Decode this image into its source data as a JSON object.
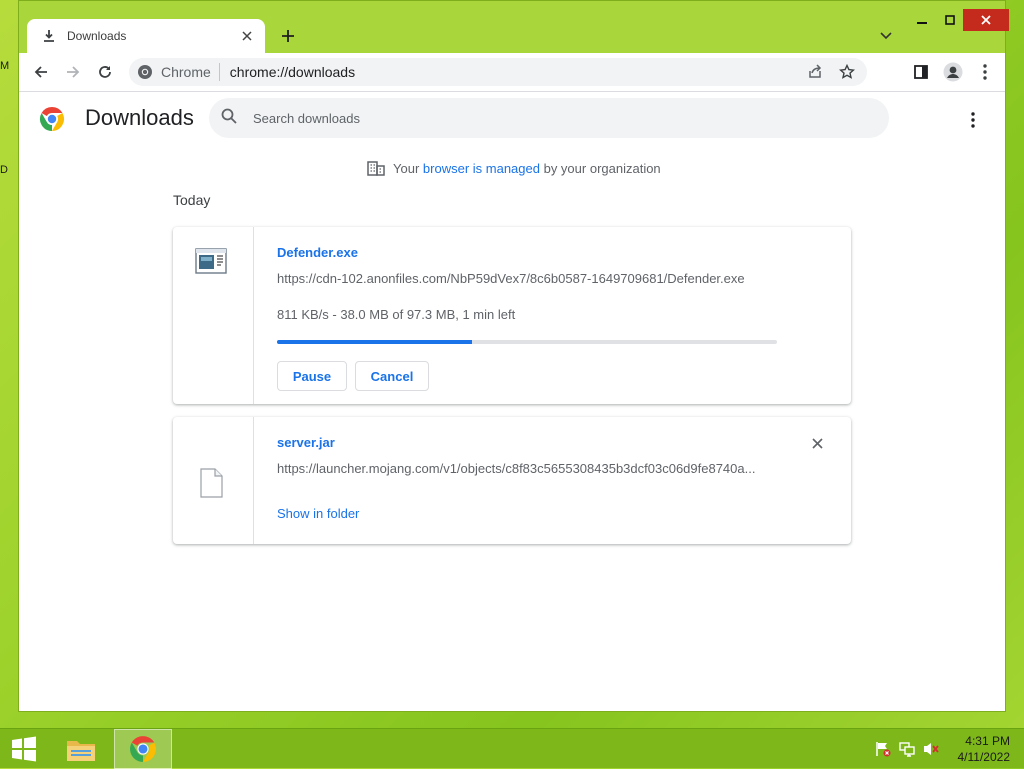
{
  "desktop": {
    "edge_fragment_1": "M",
    "edge_fragment_2": "D"
  },
  "tab": {
    "title": "Downloads",
    "icon": "download-icon",
    "close": "close-icon"
  },
  "toolbar": {
    "site_label": "Chrome",
    "url": "chrome://downloads"
  },
  "page": {
    "title": "Downloads",
    "search_placeholder": "Search downloads",
    "managed": {
      "prefix": "Your",
      "link": "browser is managed",
      "suffix": "by your organization"
    },
    "day_label": "Today"
  },
  "downloads": [
    {
      "name": "Defender.exe",
      "url": "https://cdn-102.anonfiles.com/NbP59dVex7/8c6b0587-1649709681/Defender.exe",
      "status": "811 KB/s - 38.0 MB of 97.3 MB, 1 min left",
      "progress": 0.39,
      "buffered": 0.44,
      "pause_label": "Pause",
      "cancel_label": "Cancel",
      "icon": "executable-file-icon"
    },
    {
      "name": "server.jar",
      "url": "https://launcher.mojang.com/v1/objects/c8f83c5655308435b3dcf03c06d9fe8740a...",
      "action_label": "Show in folder",
      "icon": "document-file-icon"
    }
  ],
  "taskbar": {
    "time": "4:31 PM",
    "date": "4/11/2022"
  },
  "colors": {
    "accent": "#1a73e8",
    "frame": "#a9d63a",
    "taskbar": "#7eb71a",
    "close": "#c42b1c"
  }
}
